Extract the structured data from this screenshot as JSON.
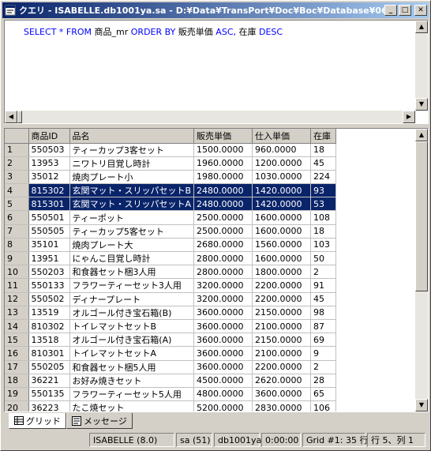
{
  "window": {
    "title": "クエリ - ISABELLE.db1001ya.sa - D:¥Data¥TransPort¥Doc¥Boc¥Database¥06...",
    "minimize": "_",
    "maximize": "□",
    "close": "✕"
  },
  "editor": {
    "sql_parts": {
      "p1": "SELECT * FROM ",
      "p2": "商品_mr",
      "p3": " ORDER BY ",
      "p4": "販売単価",
      "p5": " ASC, ",
      "p6": "在庫",
      "p7": " DESC"
    }
  },
  "grid": {
    "columns": [
      "商品ID",
      "品名",
      "販売単価",
      "仕入単価",
      "在庫"
    ],
    "rows": [
      {
        "n": "1",
        "id": "550503",
        "name": "ティーカップ3客セット",
        "price": "1500.0000",
        "cost": "960.0000",
        "stock": "18"
      },
      {
        "n": "2",
        "id": "13953",
        "name": "ニワトリ目覚し時計",
        "price": "1960.0000",
        "cost": "1200.0000",
        "stock": "45"
      },
      {
        "n": "3",
        "id": "35012",
        "name": "焼肉プレート小",
        "price": "1980.0000",
        "cost": "1030.0000",
        "stock": "224"
      },
      {
        "n": "4",
        "id": "815302",
        "name": "玄関マット・スリッパセットB",
        "price": "2480.0000",
        "cost": "1420.0000",
        "stock": "93"
      },
      {
        "n": "5",
        "id": "815301",
        "name": "玄関マット・スリッパセットA",
        "price": "2480.0000",
        "cost": "1420.0000",
        "stock": "53"
      },
      {
        "n": "6",
        "id": "550501",
        "name": "ティーポット",
        "price": "2500.0000",
        "cost": "1600.0000",
        "stock": "108"
      },
      {
        "n": "7",
        "id": "550505",
        "name": "ティーカップ5客セット",
        "price": "2500.0000",
        "cost": "1600.0000",
        "stock": "18"
      },
      {
        "n": "8",
        "id": "35101",
        "name": "焼肉プレート大",
        "price": "2680.0000",
        "cost": "1560.0000",
        "stock": "103"
      },
      {
        "n": "9",
        "id": "13951",
        "name": "にゃんこ目覚し時計",
        "price": "2800.0000",
        "cost": "1600.0000",
        "stock": "50"
      },
      {
        "n": "10",
        "id": "550203",
        "name": "和食器セット梱3人用",
        "price": "2800.0000",
        "cost": "1800.0000",
        "stock": "2"
      },
      {
        "n": "11",
        "id": "550133",
        "name": "フラワーティーセット3人用",
        "price": "3200.0000",
        "cost": "2200.0000",
        "stock": "91"
      },
      {
        "n": "12",
        "id": "550502",
        "name": "ディナープレート",
        "price": "3200.0000",
        "cost": "2200.0000",
        "stock": "45"
      },
      {
        "n": "13",
        "id": "13519",
        "name": "オルゴール付き宝石箱(B)",
        "price": "3600.0000",
        "cost": "2150.0000",
        "stock": "98"
      },
      {
        "n": "14",
        "id": "810302",
        "name": "トイレマットセットB",
        "price": "3600.0000",
        "cost": "2100.0000",
        "stock": "87"
      },
      {
        "n": "15",
        "id": "13518",
        "name": "オルゴール付き宝石箱(A)",
        "price": "3600.0000",
        "cost": "2150.0000",
        "stock": "69"
      },
      {
        "n": "16",
        "id": "810301",
        "name": "トイレマットセットA",
        "price": "3600.0000",
        "cost": "2100.0000",
        "stock": "9"
      },
      {
        "n": "17",
        "id": "550205",
        "name": "和食器セット梱5人用",
        "price": "3600.0000",
        "cost": "2200.0000",
        "stock": "2"
      },
      {
        "n": "18",
        "id": "36221",
        "name": "お好み焼きセット",
        "price": "4500.0000",
        "cost": "2620.0000",
        "stock": "28"
      },
      {
        "n": "19",
        "id": "550135",
        "name": "フラワーティーセット5人用",
        "price": "4800.0000",
        "cost": "3600.0000",
        "stock": "65"
      },
      {
        "n": "20",
        "id": "36223",
        "name": "たこ焼セット",
        "price": "5200.0000",
        "cost": "2830.0000",
        "stock": "106"
      }
    ]
  },
  "tabs": {
    "grid": "グリッド",
    "messages": "メッセージ"
  },
  "status": {
    "server": "ISABELLE (8.0)",
    "user": "sa (51)",
    "database": "db1001ya",
    "time": "0:00:00",
    "grid": "Grid #1: 35 行",
    "position": "行 5、列 1"
  },
  "colors": {
    "selection": "#0a246a",
    "keyword": "#0000ff",
    "title_start": "#0a246a",
    "title_end": "#a6caf0"
  }
}
